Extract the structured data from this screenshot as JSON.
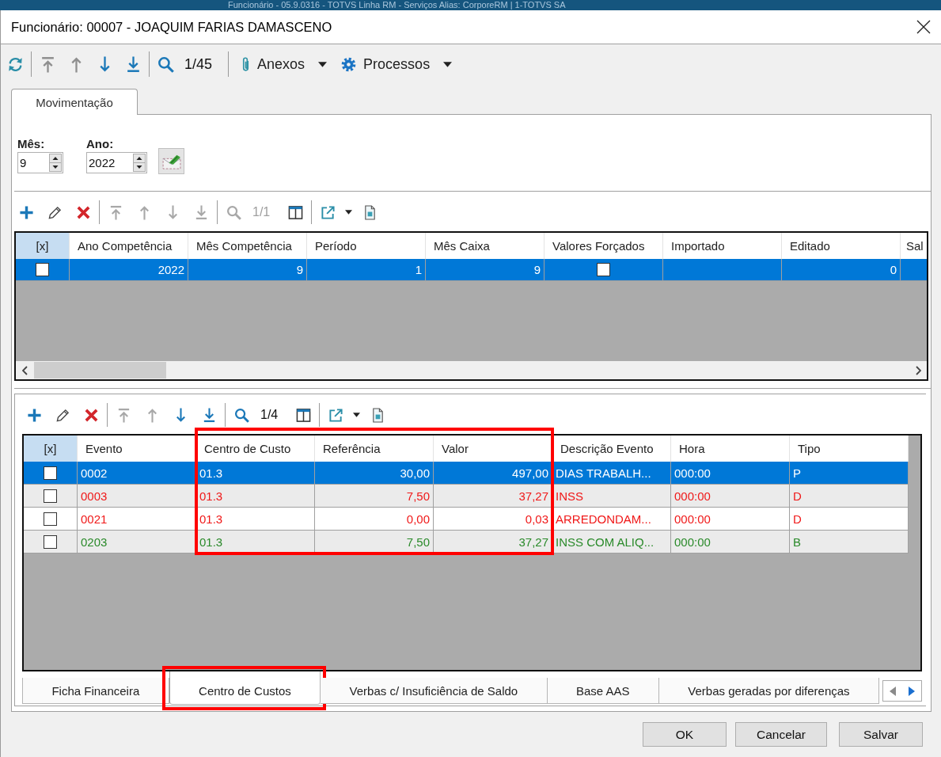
{
  "background_window": {
    "title": "Funcionário - 05.9.0316 - TOTVS Linha RM - Serviços Alias: CorporeRM | 1-TOTVS SA"
  },
  "window": {
    "title": "Funcionário: 00007 - JOAQUIM FARIAS DAMASCENO"
  },
  "toolbar": [
    {
      "kind": "refresh",
      "disabled": false
    },
    {
      "kind": "separator"
    },
    {
      "kind": "first",
      "disabled": true
    },
    {
      "kind": "previous",
      "disabled": true
    },
    {
      "kind": "next",
      "disabled": false
    },
    {
      "kind": "last",
      "disabled": false
    },
    {
      "kind": "separator"
    },
    {
      "kind": "search",
      "disabled": false
    },
    {
      "kind": "counter",
      "text": "1/45",
      "disabled": false
    },
    {
      "kind": "separator"
    },
    {
      "kind": "attach-menu",
      "label": "Anexos"
    },
    {
      "kind": "settings-menu",
      "label": "Processos"
    }
  ],
  "tabs": [
    {
      "label": "Movimentação",
      "selected": true
    }
  ],
  "filters": [
    {
      "label": "Mês:",
      "value": "9"
    },
    {
      "label": "Ano:",
      "value": "2022"
    }
  ],
  "upper_grid": {
    "toolbar": [
      {
        "kind": "add",
        "disabled": false
      },
      {
        "kind": "edit",
        "disabled": false
      },
      {
        "kind": "delete",
        "disabled": false
      },
      {
        "kind": "separator"
      },
      {
        "kind": "first",
        "disabled": true
      },
      {
        "kind": "previous",
        "disabled": true
      },
      {
        "kind": "next",
        "disabled": true
      },
      {
        "kind": "last",
        "disabled": true
      },
      {
        "kind": "separator"
      },
      {
        "kind": "search",
        "disabled": true
      },
      {
        "kind": "counter",
        "text": "1/1",
        "disabled": true
      },
      {
        "kind": "columns",
        "disabled": false
      },
      {
        "kind": "separator"
      },
      {
        "kind": "export",
        "disabled": false
      },
      {
        "kind": "document",
        "disabled": false
      }
    ],
    "columns": [
      {
        "label": "[x]",
        "kind": "selector"
      },
      {
        "label": "Ano Competência",
        "kind": "number"
      },
      {
        "label": "Mês Competência",
        "kind": "number"
      },
      {
        "label": "Período",
        "kind": "number"
      },
      {
        "label": "Mês Caixa",
        "kind": "number"
      },
      {
        "label": "Valores Forçados",
        "kind": "check"
      },
      {
        "label": "Importado",
        "kind": "text"
      },
      {
        "label": "Editado",
        "kind": "number"
      },
      {
        "label": "Sal",
        "kind": "text"
      }
    ],
    "rows": [
      {
        "selected": true,
        "cells": [
          {
            "checked": false
          },
          {
            "text": "2022"
          },
          {
            "text": "9"
          },
          {
            "text": "1"
          },
          {
            "text": "9"
          },
          {
            "checked": false
          },
          {},
          {
            "text": "0"
          },
          {}
        ]
      }
    ]
  },
  "lower_grid": {
    "toolbar": [
      {
        "kind": "add",
        "disabled": false
      },
      {
        "kind": "edit",
        "disabled": false
      },
      {
        "kind": "delete",
        "disabled": false
      },
      {
        "kind": "separator"
      },
      {
        "kind": "first",
        "disabled": true
      },
      {
        "kind": "previous",
        "disabled": true
      },
      {
        "kind": "next",
        "disabled": false
      },
      {
        "kind": "last",
        "disabled": false
      },
      {
        "kind": "separator"
      },
      {
        "kind": "search",
        "disabled": false
      },
      {
        "kind": "counter",
        "text": "1/4",
        "disabled": false
      },
      {
        "kind": "columns",
        "disabled": false
      },
      {
        "kind": "separator"
      },
      {
        "kind": "export",
        "disabled": false
      },
      {
        "kind": "document",
        "disabled": false
      }
    ],
    "columns": [
      {
        "label": "[x]",
        "kind": "selector",
        "highlighted": false
      },
      {
        "label": "Evento",
        "kind": "text",
        "highlighted": false
      },
      {
        "label": "Centro de Custo",
        "kind": "text",
        "highlighted": true
      },
      {
        "label": "Referência",
        "kind": "number",
        "highlighted": true
      },
      {
        "label": "Valor",
        "kind": "number",
        "highlighted": true
      },
      {
        "label": "Descrição Evento",
        "kind": "text",
        "highlighted": false
      },
      {
        "label": "Hora",
        "kind": "text",
        "highlighted": false
      },
      {
        "label": "Tipo",
        "kind": "text",
        "highlighted": false
      }
    ],
    "rows": [
      {
        "selected": true,
        "cells": [
          {
            "checked": false
          },
          {
            "text": "0002"
          },
          {
            "text": "01.3"
          },
          {
            "text": "30,00"
          },
          {
            "text": "497,00"
          },
          {
            "text": "DIAS TRABALH..."
          },
          {
            "text": "000:00"
          },
          {
            "text": "P"
          }
        ]
      },
      {
        "selected": false,
        "color": "#f01818",
        "cells": [
          {
            "checked": false
          },
          {
            "text": "0003"
          },
          {
            "text": "01.3"
          },
          {
            "text": "7,50"
          },
          {
            "text": "37,27"
          },
          {
            "text": "INSS"
          },
          {
            "text": "000:00"
          },
          {
            "text": "D"
          }
        ]
      },
      {
        "selected": false,
        "color": "#f01818",
        "cells": [
          {
            "checked": false
          },
          {
            "text": "0021"
          },
          {
            "text": "01.3"
          },
          {
            "text": "0,00"
          },
          {
            "text": "0,03"
          },
          {
            "text": "ARREDONDAM..."
          },
          {
            "text": "000:00"
          },
          {
            "text": "D"
          }
        ]
      },
      {
        "selected": false,
        "color": "#2a8a2a",
        "cells": [
          {
            "checked": false
          },
          {
            "text": "0203"
          },
          {
            "text": "01.3"
          },
          {
            "text": "7,50"
          },
          {
            "text": "37,27"
          },
          {
            "text": "INSS COM ALIQ..."
          },
          {
            "text": "000:00"
          },
          {
            "text": "B"
          }
        ]
      }
    ]
  },
  "bottom_tabs": [
    {
      "label": "Ficha Financeira",
      "selected": false,
      "highlighted": false
    },
    {
      "label": "Centro de Custos",
      "selected": true,
      "highlighted": true
    },
    {
      "label": "Verbas c/ Insuficiência de Saldo",
      "selected": false,
      "highlighted": false
    },
    {
      "label": "Base AAS",
      "selected": false,
      "highlighted": false
    },
    {
      "label": "Verbas geradas por diferenças",
      "selected": false,
      "highlighted": false
    }
  ],
  "buttons": [
    "OK",
    "Cancelar",
    "Salvar"
  ]
}
